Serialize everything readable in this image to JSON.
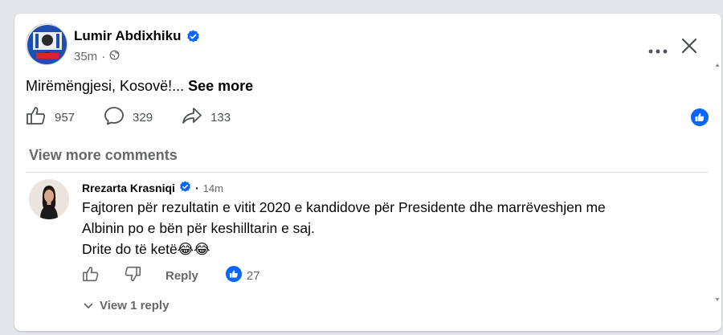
{
  "post": {
    "author": "Lumir Abdixhiku",
    "time": "35m",
    "text": "Mirëmëngjesi, Kosovë!...",
    "see_more": "See more",
    "likes": "957",
    "comments": "329",
    "shares": "133"
  },
  "comments_section": {
    "view_more": "View more comments",
    "comment": {
      "author": "Rrezarta Krasniqi",
      "time": "14m",
      "line1": "Fajtoren për rezultatin e vitit 2020 e kandidove për Presidente dhe marrëveshjen me",
      "line2": "Albinin po e bën për keshilltarin e saj.",
      "line3": "Drite do të ketë😂😂",
      "reply_label": "Reply",
      "reaction_count": "27",
      "view_reply": "View 1 reply"
    }
  },
  "colors": {
    "accent_blue": "#0866ff",
    "secondary_text": "#65676b"
  },
  "icons": [
    "verified-icon",
    "globe-icon",
    "more-icon",
    "close-icon",
    "like-icon",
    "comment-icon",
    "share-icon",
    "like-reaction-icon",
    "dislike-icon",
    "chevron-down-icon"
  ]
}
